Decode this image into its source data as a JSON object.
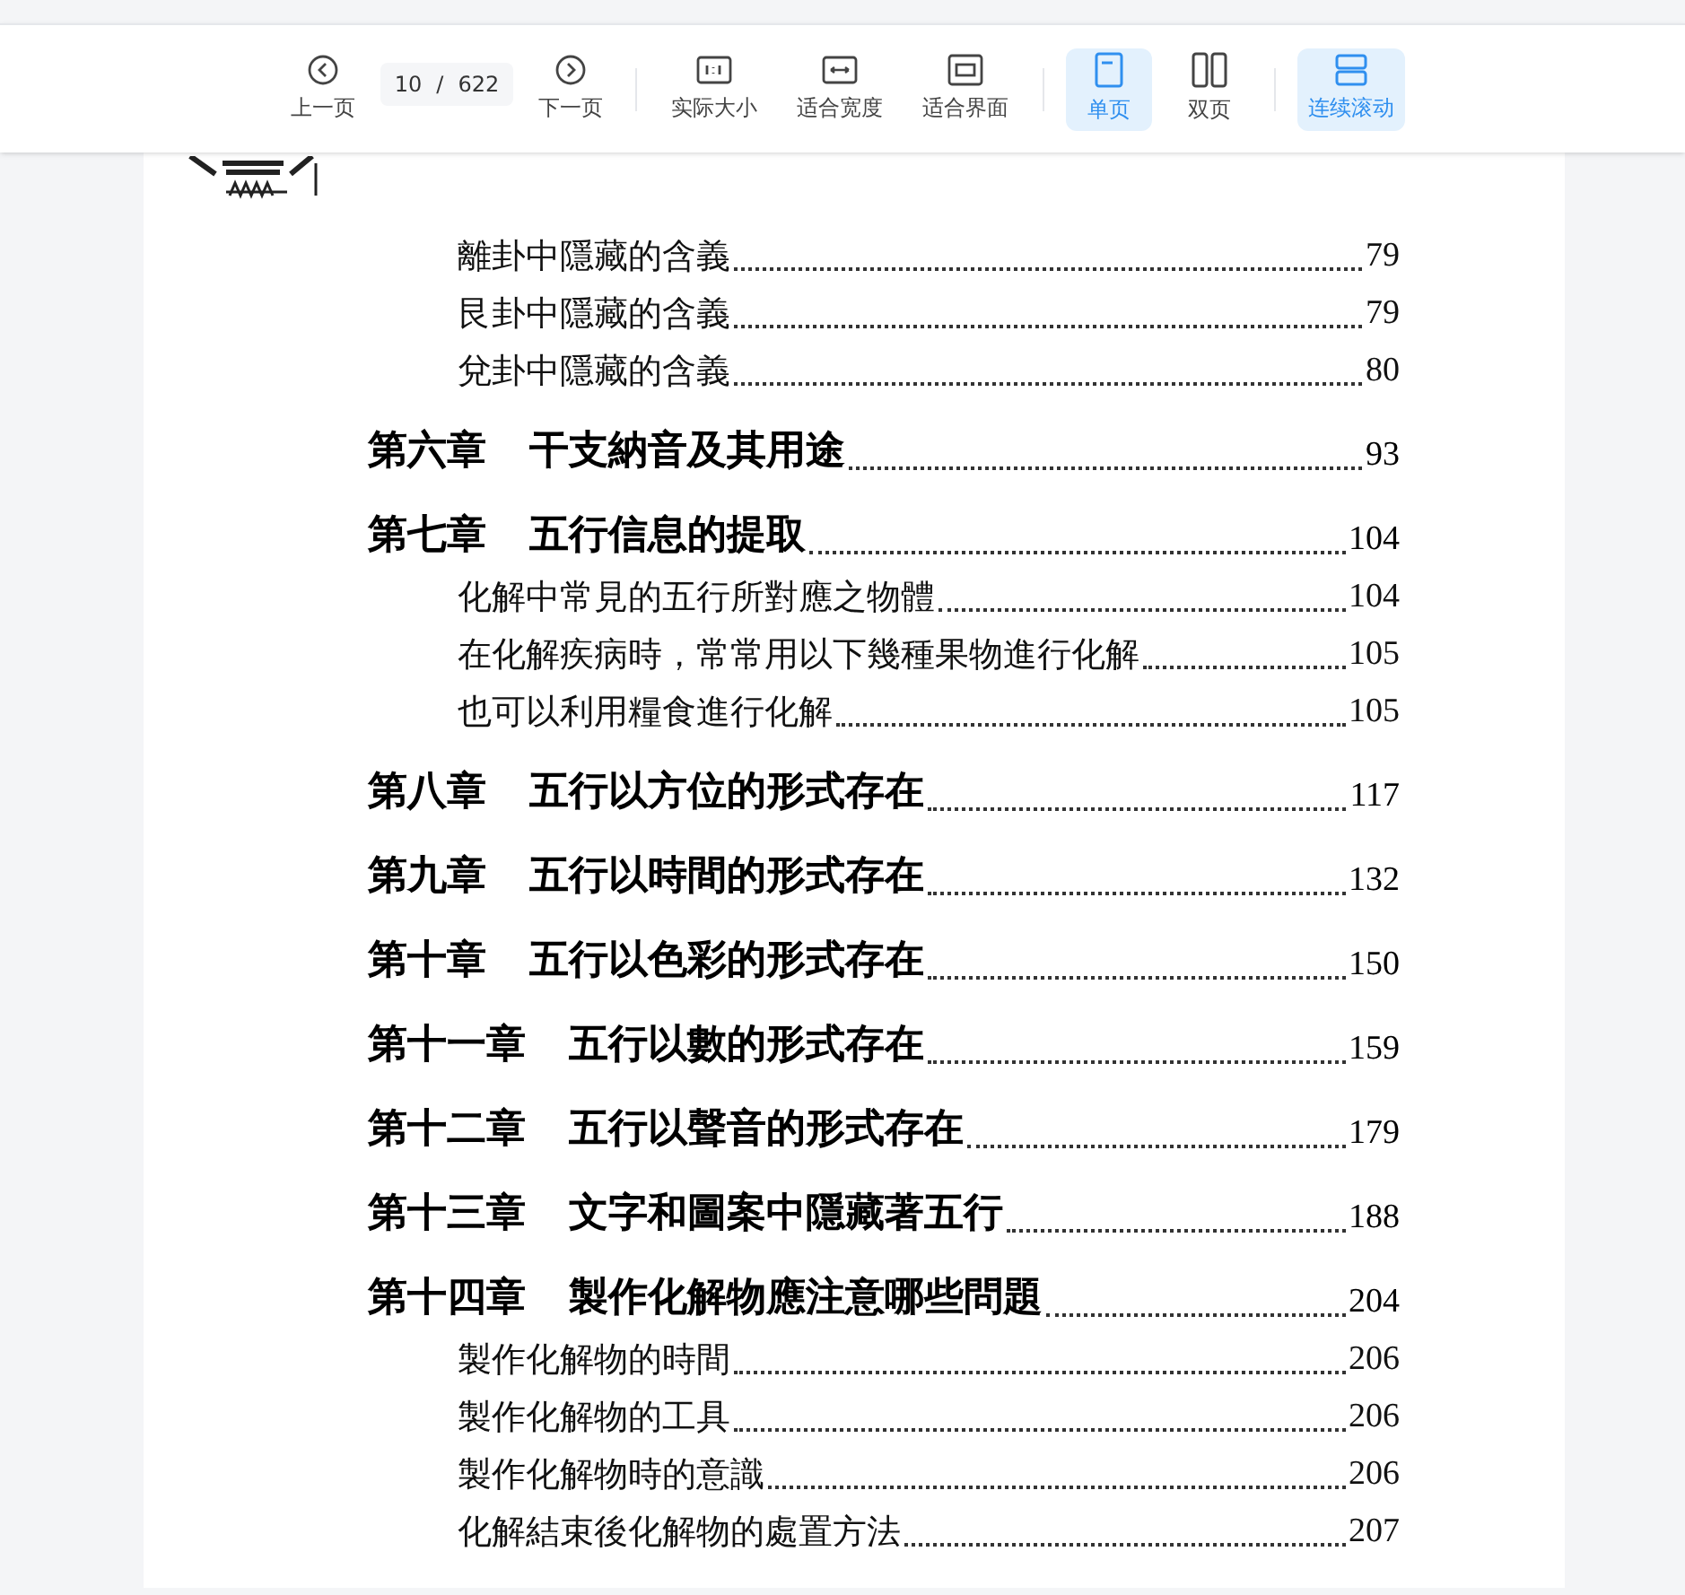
{
  "toolbar": {
    "prev": "上一页",
    "page_current": "10",
    "page_separator": "/",
    "page_total": "622",
    "next": "下一页",
    "views": [
      {
        "label": "实际大小",
        "kind": "actual",
        "selected": false
      },
      {
        "label": "适合宽度",
        "kind": "width",
        "selected": false
      },
      {
        "label": "适合界面",
        "kind": "fit",
        "selected": false
      }
    ],
    "layouts": [
      {
        "label": "单页",
        "kind": "single",
        "selected": true
      },
      {
        "label": "双页",
        "kind": "double",
        "selected": false
      }
    ],
    "scroll": {
      "label": "连续滚动",
      "selected": true
    }
  },
  "toc": [
    {
      "kind": "section",
      "title": "離卦中隱藏的含義",
      "page": "79"
    },
    {
      "kind": "section",
      "title": "艮卦中隱藏的含義",
      "page": "79"
    },
    {
      "kind": "section",
      "title": "兌卦中隱藏的含義",
      "page": "80"
    },
    {
      "kind": "chapter",
      "number": "第六章",
      "title": "干支納音及其用途",
      "page": "93"
    },
    {
      "kind": "chapter",
      "number": "第七章",
      "title": "五行信息的提取",
      "page": "104"
    },
    {
      "kind": "section",
      "title": "化解中常見的五行所對應之物體",
      "page": "104"
    },
    {
      "kind": "section",
      "title": "在化解疾病時，常常用以下幾種果物進行化解",
      "page": "105"
    },
    {
      "kind": "section",
      "title": "也可以利用糧食進行化解",
      "page": "105"
    },
    {
      "kind": "chapter",
      "number": "第八章",
      "title": "五行以方位的形式存在",
      "page": "117"
    },
    {
      "kind": "chapter",
      "number": "第九章",
      "title": "五行以時間的形式存在",
      "page": "132"
    },
    {
      "kind": "chapter",
      "number": "第十章",
      "title": "五行以色彩的形式存在",
      "page": "150"
    },
    {
      "kind": "chapter",
      "number": "第十一章",
      "title": "五行以數的形式存在",
      "page": "159"
    },
    {
      "kind": "chapter",
      "number": "第十二章",
      "title": "五行以聲音的形式存在",
      "page": "179"
    },
    {
      "kind": "chapter",
      "number": "第十三章",
      "title": "文字和圖案中隱藏著五行",
      "page": "188"
    },
    {
      "kind": "chapter",
      "number": "第十四章",
      "title": "製作化解物應注意哪些問題",
      "page": "204"
    },
    {
      "kind": "section",
      "title": "製作化解物的時間",
      "page": "206"
    },
    {
      "kind": "section",
      "title": "製作化解物的工具",
      "page": "206"
    },
    {
      "kind": "section",
      "title": "製作化解物時的意識",
      "page": "206"
    },
    {
      "kind": "section",
      "title": "化解結束後化解物的處置方法",
      "page": "207"
    }
  ]
}
